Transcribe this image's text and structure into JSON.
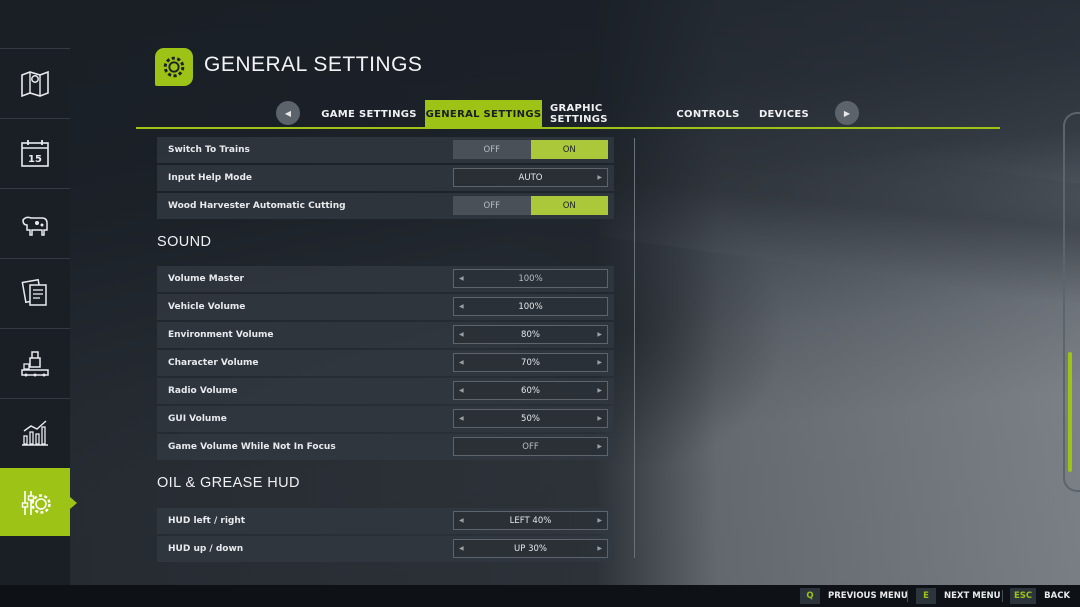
{
  "header": {
    "title": "GENERAL SETTINGS",
    "icon": "gear-icon"
  },
  "tabs": {
    "items": [
      {
        "label": "GAME SETTINGS"
      },
      {
        "label": "GENERAL SETTINGS",
        "active": true
      },
      {
        "label": "GRAPHIC SETTINGS"
      },
      {
        "label": "CONTROLS"
      },
      {
        "label": "DEVICES"
      }
    ],
    "prev_arrow": "◀",
    "next_arrow": "▶"
  },
  "sidebar": {
    "items": [
      {
        "icon": "map-icon"
      },
      {
        "icon": "calendar-icon",
        "text": "15"
      },
      {
        "icon": "animals-icon"
      },
      {
        "icon": "contracts-icon"
      },
      {
        "icon": "production-icon"
      },
      {
        "icon": "statistics-icon"
      },
      {
        "icon": "settings-icon",
        "active": true
      }
    ]
  },
  "toggle_labels": {
    "off": "OFF",
    "on": "ON"
  },
  "general_rows": [
    {
      "label": "Switch To Trains",
      "type": "toggle",
      "value": "ON"
    },
    {
      "label": "Input Help Mode",
      "type": "selector",
      "value": "AUTO"
    },
    {
      "label": "Wood Harvester Automatic Cutting",
      "type": "toggle",
      "value": "ON"
    }
  ],
  "sound": {
    "title": "SOUND",
    "rows": [
      {
        "label": "Volume Master",
        "value": "100%"
      },
      {
        "label": "Vehicle Volume",
        "value": "100%"
      },
      {
        "label": "Environment Volume",
        "value": "80%"
      },
      {
        "label": "Character Volume",
        "value": "70%"
      },
      {
        "label": "Radio Volume",
        "value": "60%"
      },
      {
        "label": "GUI Volume",
        "value": "50%"
      },
      {
        "label": "Game Volume While Not In Focus",
        "value": "OFF"
      }
    ]
  },
  "oil_hud": {
    "title": "OIL & GREASE HUD",
    "rows": [
      {
        "label": "HUD left / right",
        "value": "LEFT 40%"
      },
      {
        "label": "HUD up / down",
        "value": "UP 30%"
      }
    ]
  },
  "footer": {
    "hints": [
      {
        "key": "Q",
        "label": "PREVIOUS MENU"
      },
      {
        "key": "E",
        "label": "NEXT MENU"
      },
      {
        "key": "ESC",
        "label": "BACK"
      }
    ]
  },
  "colors": {
    "accent": "#9cc316",
    "panel": "#323840",
    "sidebar": "#1a1f25"
  }
}
